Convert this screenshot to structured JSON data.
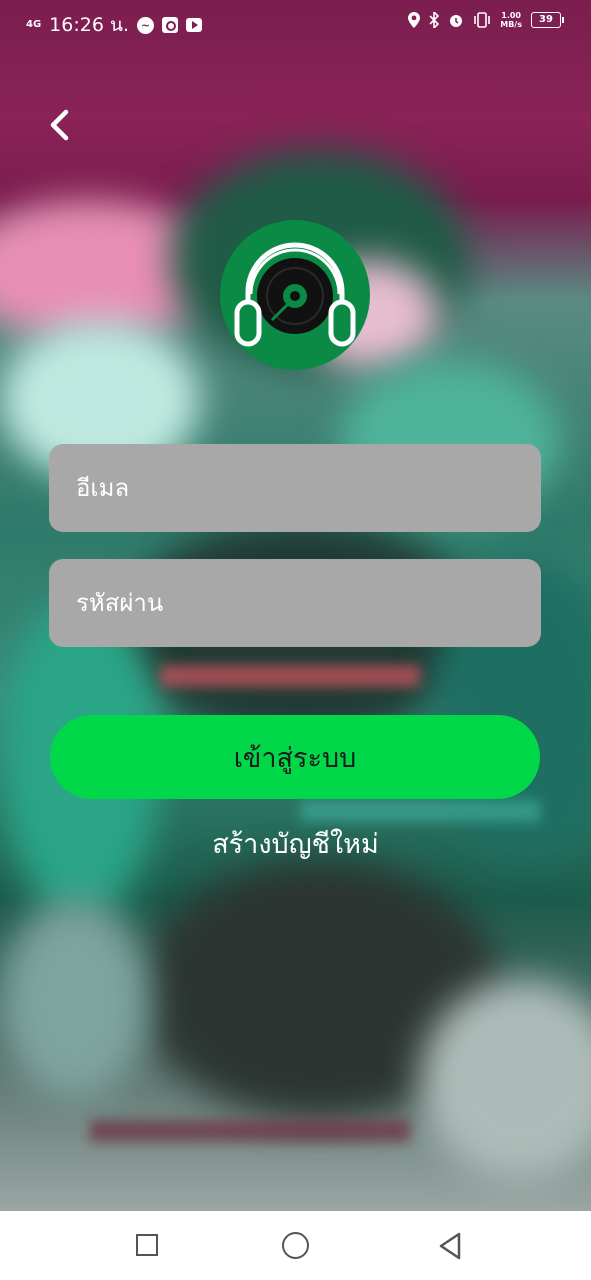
{
  "status_bar": {
    "network": "4G",
    "time": "16:26 น.",
    "speed_value": "1.00",
    "speed_unit": "MB/s",
    "battery": "39"
  },
  "form": {
    "email_placeholder": "อีเมล",
    "password_placeholder": "รหัสผ่าน",
    "login_label": "เข้าสู่ระบบ",
    "register_label": "สร้างบัญชีใหม่"
  },
  "colors": {
    "logo_bg": "#0a8a45",
    "login_button": "#00d84a",
    "field_bg": "#a8a8a8"
  },
  "icons": {
    "back": "chevron-left-icon",
    "logo": "headphones-disc-icon",
    "nav_recent": "square-icon",
    "nav_home": "circle-icon",
    "nav_back": "triangle-back-icon"
  }
}
